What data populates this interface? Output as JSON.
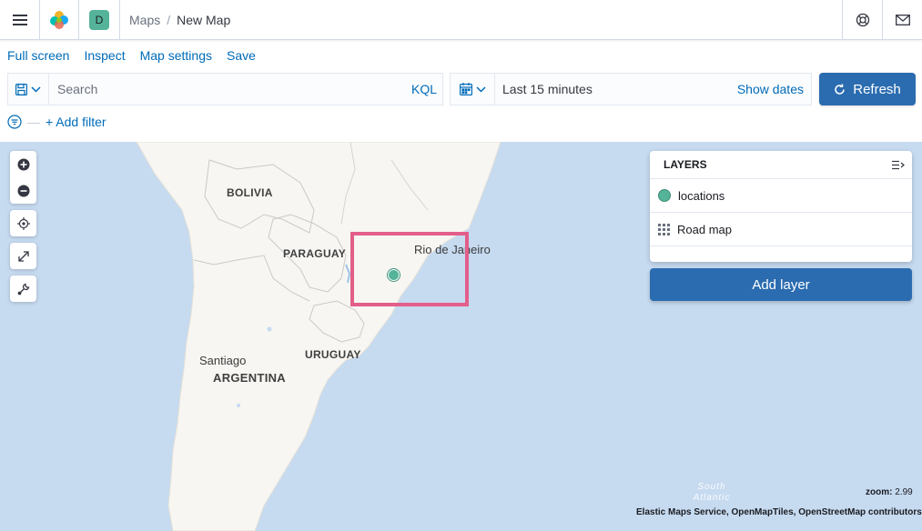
{
  "header": {
    "space_initial": "D",
    "breadcrumbs": [
      "Maps",
      "New Map"
    ],
    "breadcrumb_sep": "/"
  },
  "topnav": [
    "Full screen",
    "Inspect",
    "Map settings",
    "Save"
  ],
  "querybar": {
    "placeholder": "Search",
    "language": "KQL"
  },
  "timepicker": {
    "range": "Last 15 minutes",
    "show_dates": "Show dates"
  },
  "refresh_label": "Refresh",
  "add_filter_label": "+ Add filter",
  "layers_panel": {
    "title": "LAYERS",
    "layers": [
      {
        "name": "locations",
        "icon": "green-circle"
      },
      {
        "name": "Road map",
        "icon": "grid-icon"
      }
    ],
    "add_layer_label": "Add layer"
  },
  "map": {
    "labels": {
      "bolivia": "BOLIVIA",
      "paraguay": "PARAGUAY",
      "rio": "Rio de Janeiro",
      "santiago": "Santiago",
      "uruguay": "URUGUAY",
      "argentina": "ARGENTINA",
      "ocean": "South Atlantic"
    },
    "zoom_label": "zoom:",
    "zoom_value": "2.99",
    "attribution": "Elastic Maps Service, OpenMapTiles, OpenStreetMap contributors"
  },
  "colors": {
    "accent": "#2b6cb0",
    "link": "#006bb8",
    "point": "#54b399",
    "highlight": "#e35e8a",
    "water": "#c6daf0",
    "land": "#f7f6f2"
  }
}
